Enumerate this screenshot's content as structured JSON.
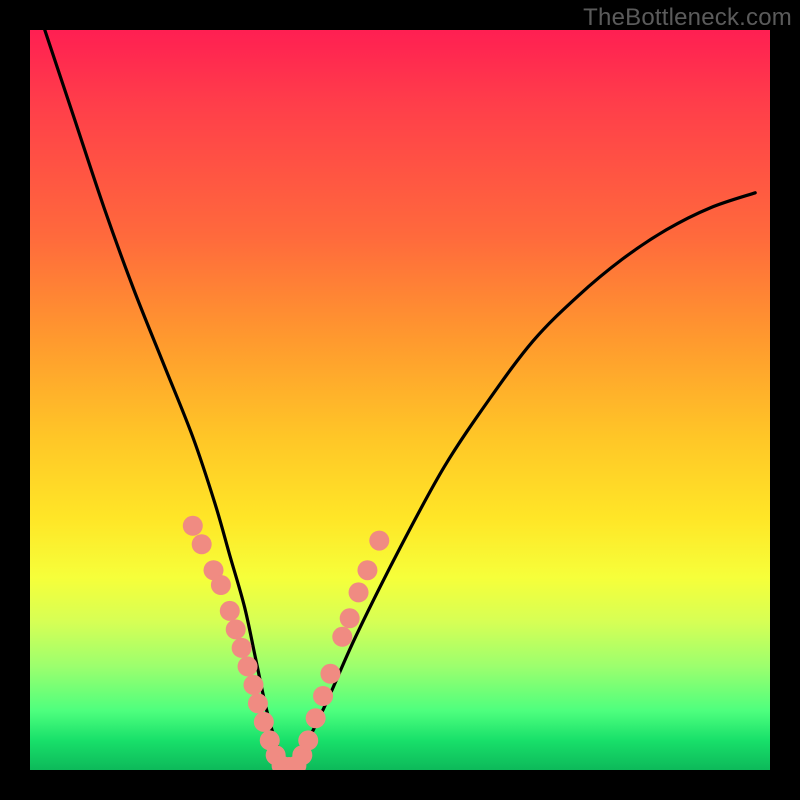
{
  "watermark": "TheBottleneck.com",
  "chart_data": {
    "type": "line",
    "title": "",
    "xlabel": "",
    "ylabel": "",
    "xlim": [
      0,
      100
    ],
    "ylim": [
      0,
      100
    ],
    "grid": false,
    "legend": false,
    "series": [
      {
        "name": "bottleneck-curve",
        "x": [
          2,
          6,
          10,
          14,
          18,
          22,
          25,
          27,
          29,
          30.5,
          32,
          33.5,
          35,
          37,
          40,
          44,
          50,
          56,
          62,
          68,
          74,
          80,
          86,
          92,
          98
        ],
        "y": [
          100,
          88,
          76,
          65,
          55,
          45,
          36,
          29,
          22,
          15,
          8,
          3,
          0.5,
          3,
          9,
          18,
          30,
          41,
          50,
          58,
          64,
          69,
          73,
          76,
          78
        ]
      }
    ],
    "markers": [
      {
        "name": "left-cluster",
        "color": "#f08b82",
        "points": [
          {
            "x": 22.0,
            "y": 33.0
          },
          {
            "x": 23.2,
            "y": 30.5
          },
          {
            "x": 24.8,
            "y": 27.0
          },
          {
            "x": 25.8,
            "y": 25.0
          },
          {
            "x": 27.0,
            "y": 21.5
          },
          {
            "x": 27.8,
            "y": 19.0
          },
          {
            "x": 28.6,
            "y": 16.5
          },
          {
            "x": 29.4,
            "y": 14.0
          },
          {
            "x": 30.2,
            "y": 11.5
          },
          {
            "x": 30.8,
            "y": 9.0
          },
          {
            "x": 31.6,
            "y": 6.5
          },
          {
            "x": 32.4,
            "y": 4.0
          },
          {
            "x": 33.2,
            "y": 2.0
          }
        ]
      },
      {
        "name": "right-cluster",
        "color": "#f08b82",
        "points": [
          {
            "x": 36.8,
            "y": 2.0
          },
          {
            "x": 37.6,
            "y": 4.0
          },
          {
            "x": 38.6,
            "y": 7.0
          },
          {
            "x": 39.6,
            "y": 10.0
          },
          {
            "x": 40.6,
            "y": 13.0
          },
          {
            "x": 42.2,
            "y": 18.0
          },
          {
            "x": 43.2,
            "y": 20.5
          },
          {
            "x": 44.4,
            "y": 24.0
          },
          {
            "x": 45.6,
            "y": 27.0
          },
          {
            "x": 47.2,
            "y": 31.0
          }
        ]
      },
      {
        "name": "bottom-cluster",
        "color": "#f08b82",
        "points": [
          {
            "x": 34.0,
            "y": 0.6
          },
          {
            "x": 35.0,
            "y": 0.4
          },
          {
            "x": 36.0,
            "y": 0.6
          }
        ]
      }
    ]
  }
}
